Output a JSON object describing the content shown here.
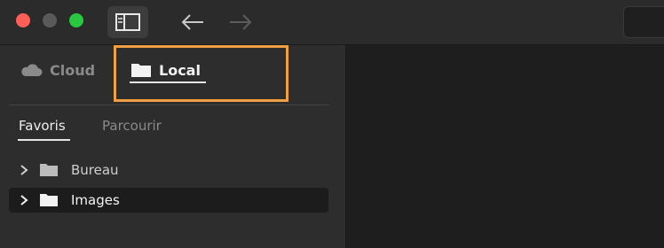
{
  "window": {
    "traffic_lights": {
      "close_color": "#ff5f57",
      "minimize_color": "#5a5a5a",
      "maximize_color": "#28c840"
    }
  },
  "toolbar": {
    "sidebar_toggle_icon": "sidebar-toggle-icon",
    "back_icon": "arrow-left-icon",
    "forward_icon": "arrow-right-icon"
  },
  "source_tabs": {
    "cloud": {
      "label": "Cloud",
      "icon": "cloud-icon",
      "active": false
    },
    "local": {
      "label": "Local",
      "icon": "folder-icon",
      "active": true
    },
    "highlight_color": "#f0a040"
  },
  "sub_tabs": {
    "favorites": {
      "label": "Favoris",
      "active": true
    },
    "browse": {
      "label": "Parcourir",
      "active": false
    }
  },
  "tree": {
    "items": [
      {
        "label": "Bureau",
        "icon": "folder-icon",
        "selected": false
      },
      {
        "label": "Images",
        "icon": "folder-icon",
        "selected": true
      }
    ]
  }
}
